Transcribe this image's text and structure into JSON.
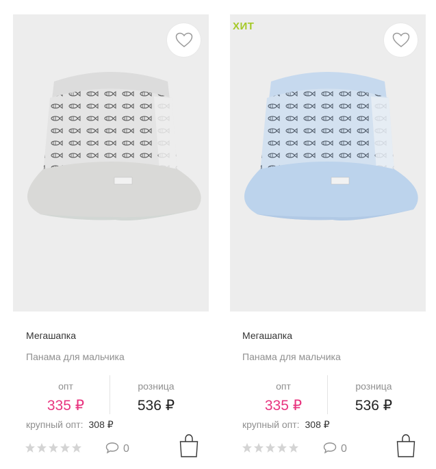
{
  "colors": {
    "accent_pink": "#e8347f",
    "hit_green": "#a5c928",
    "muted_text": "#8f8f8f",
    "photo_background": "#ededed"
  },
  "products": [
    {
      "badge": "",
      "favorite_icon": "heart-outline-icon",
      "photo": {
        "subject": "bucket-hat-with-fish-print",
        "brim_color": "#d9d9d7",
        "crown_color": "#dedede"
      },
      "brand": "Мегашапка",
      "description": "Панама для мальчика",
      "price_opt_label": "опт",
      "price_opt": "335 ₽",
      "price_retail_label": "розница",
      "price_retail": "536 ₽",
      "bulk_label": "крупный опт:",
      "bulk_price": "308 ₽",
      "rating": 0,
      "comment_icon": "speech-bubble-icon",
      "comments": "0",
      "cart_icon": "shopping-bag-icon"
    },
    {
      "badge": "ХИТ",
      "favorite_icon": "heart-outline-icon",
      "photo": {
        "subject": "bucket-hat-with-fish-print",
        "brim_color": "#bcd3ec",
        "crown_color": "#c6d9ee"
      },
      "brand": "Мегашапка",
      "description": "Панама для мальчика",
      "price_opt_label": "опт",
      "price_opt": "335 ₽",
      "price_retail_label": "розница",
      "price_retail": "536 ₽",
      "bulk_label": "крупный опт:",
      "bulk_price": "308 ₽",
      "rating": 0,
      "comment_icon": "speech-bubble-icon",
      "comments": "0",
      "cart_icon": "shopping-bag-icon"
    }
  ]
}
